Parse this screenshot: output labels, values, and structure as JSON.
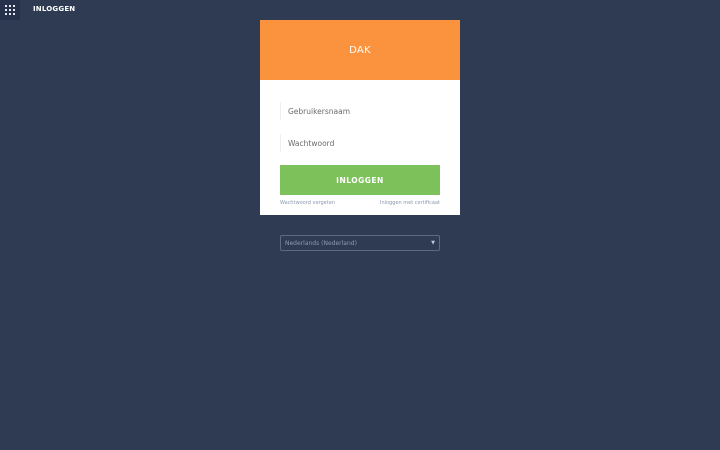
{
  "topbar": {
    "title": "INLOGGEN"
  },
  "card": {
    "brand": "DAK",
    "username_placeholder": "Gebruikersnaam",
    "password_placeholder": "Wachtwoord",
    "login_label": "INLOGGEN",
    "forgot_password": "Wachtwoord vergeten",
    "cert_login": "Inloggen met certificaat"
  },
  "language": {
    "selected": "Nederlands (Nederland)"
  },
  "colors": {
    "background": "#2e3b53",
    "header": "#fb923d",
    "button": "#7dc15a"
  }
}
